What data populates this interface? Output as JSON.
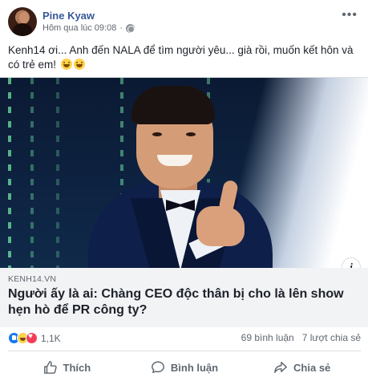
{
  "post": {
    "author": "Pine Kyaw",
    "timestamp": "Hôm qua lúc 09:08",
    "privacy_icon": "globe-icon",
    "options_icon": "more-options-icon",
    "text": "Kenh14 ơi... Anh đến NALA để tìm người yêu... già rồi, muốn kết hôn và có trẻ em!",
    "emoji_icons": [
      "grinning-sweat-emoji",
      "grinning-sweat-emoji"
    ]
  },
  "link_preview": {
    "domain": "KENH14.VN",
    "headline": "Người ấy là ai: Chàng CEO độc thân bị cho là lên show hẹn hò để PR công ty?",
    "info_label": "i"
  },
  "stats": {
    "reaction_icons": [
      "like",
      "haha",
      "love"
    ],
    "reaction_count": "1,1K",
    "comments": "69 bình luận",
    "shares": "7 lượt chia sẻ"
  },
  "actions": {
    "like_label": "Thích",
    "comment_label": "Bình luận",
    "share_label": "Chia sẻ"
  },
  "colors": {
    "author_link": "#385898",
    "secondary_text": "#606770",
    "link_bg": "#f2f3f5",
    "like_blue": "#1877f2",
    "love_red": "#f33e58",
    "haha_yellow": "#ffd24d"
  }
}
